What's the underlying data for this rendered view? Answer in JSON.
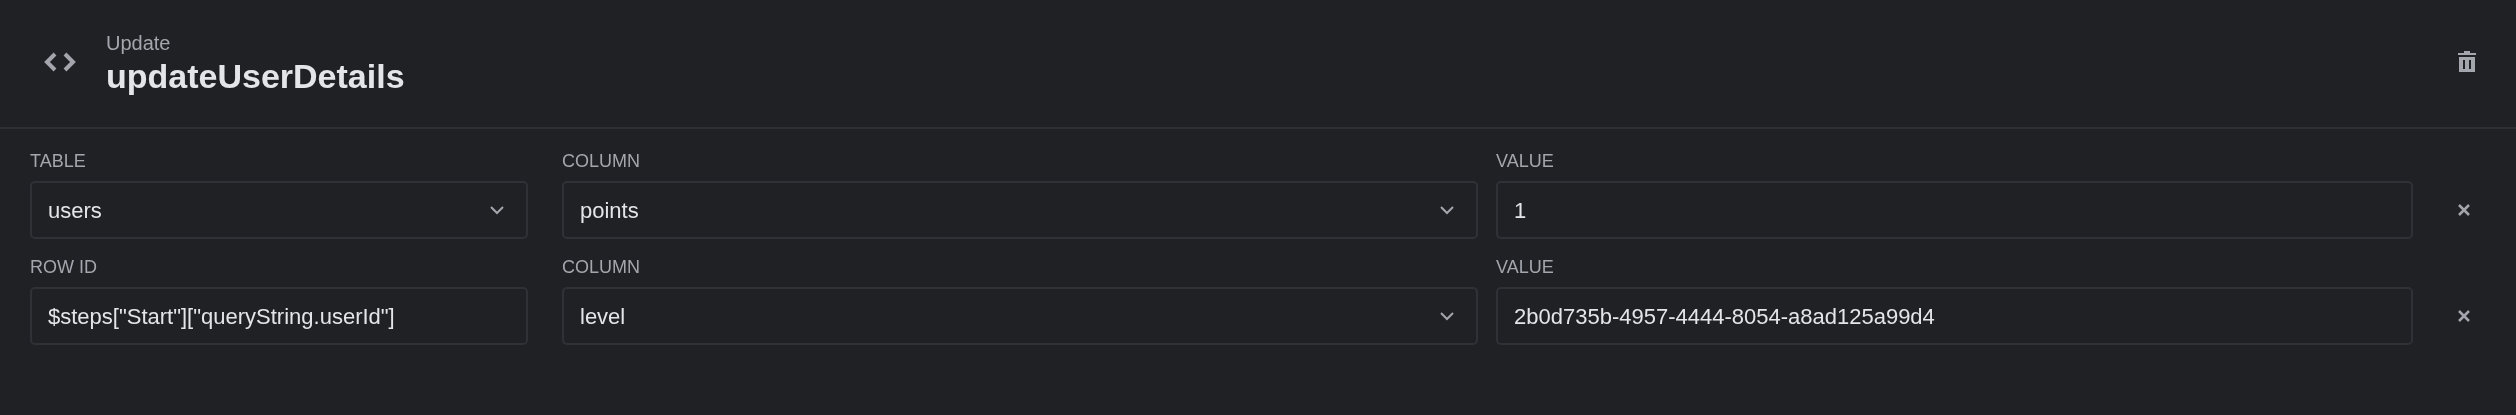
{
  "header": {
    "subtitle": "Update",
    "title": "updateUserDetails"
  },
  "rows": [
    {
      "fields": [
        {
          "label": "TABLE",
          "kind": "select",
          "value": "users"
        },
        {
          "label": "COLUMN",
          "kind": "select",
          "value": "points"
        },
        {
          "label": "VALUE",
          "kind": "input",
          "value": "1"
        }
      ]
    },
    {
      "fields": [
        {
          "label": "ROW ID",
          "kind": "input",
          "value": "$steps[\"Start\"][\"queryString.userId\"]"
        },
        {
          "label": "COLUMN",
          "kind": "select",
          "value": "level"
        },
        {
          "label": "VALUE",
          "kind": "input",
          "value": "2b0d735b-4957-4444-8054-a8ad125a99d4"
        }
      ]
    }
  ]
}
